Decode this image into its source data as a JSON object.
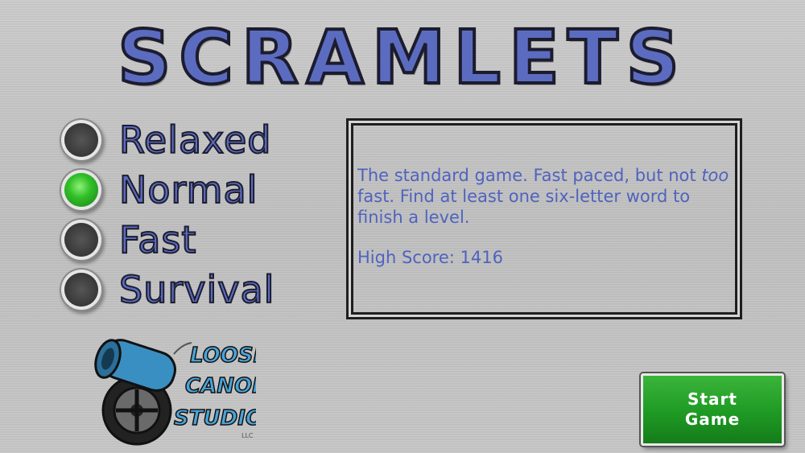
{
  "title": "SCRAMLETS",
  "modes": [
    {
      "label": "Relaxed",
      "selected": false
    },
    {
      "label": "Normal",
      "selected": true
    },
    {
      "label": "Fast",
      "selected": false
    },
    {
      "label": "Survival",
      "selected": false
    }
  ],
  "description": {
    "part1": "The standard game. Fast paced, but not ",
    "emphasis": "too",
    "part2": " fast. Find at least one six-letter word to finish a level.",
    "high_score": "High Score: 1416"
  },
  "logo": {
    "line1": "LOOSE",
    "line2": "CANON",
    "line3": "STUDIOS",
    "mark": "LLC",
    "icon": "cannon-icon"
  },
  "start_button": {
    "line1": "Start",
    "line2": "Game"
  },
  "colors": {
    "accent": "#5b6cc0",
    "selected": "#32c028",
    "button": "#1e9a24"
  }
}
